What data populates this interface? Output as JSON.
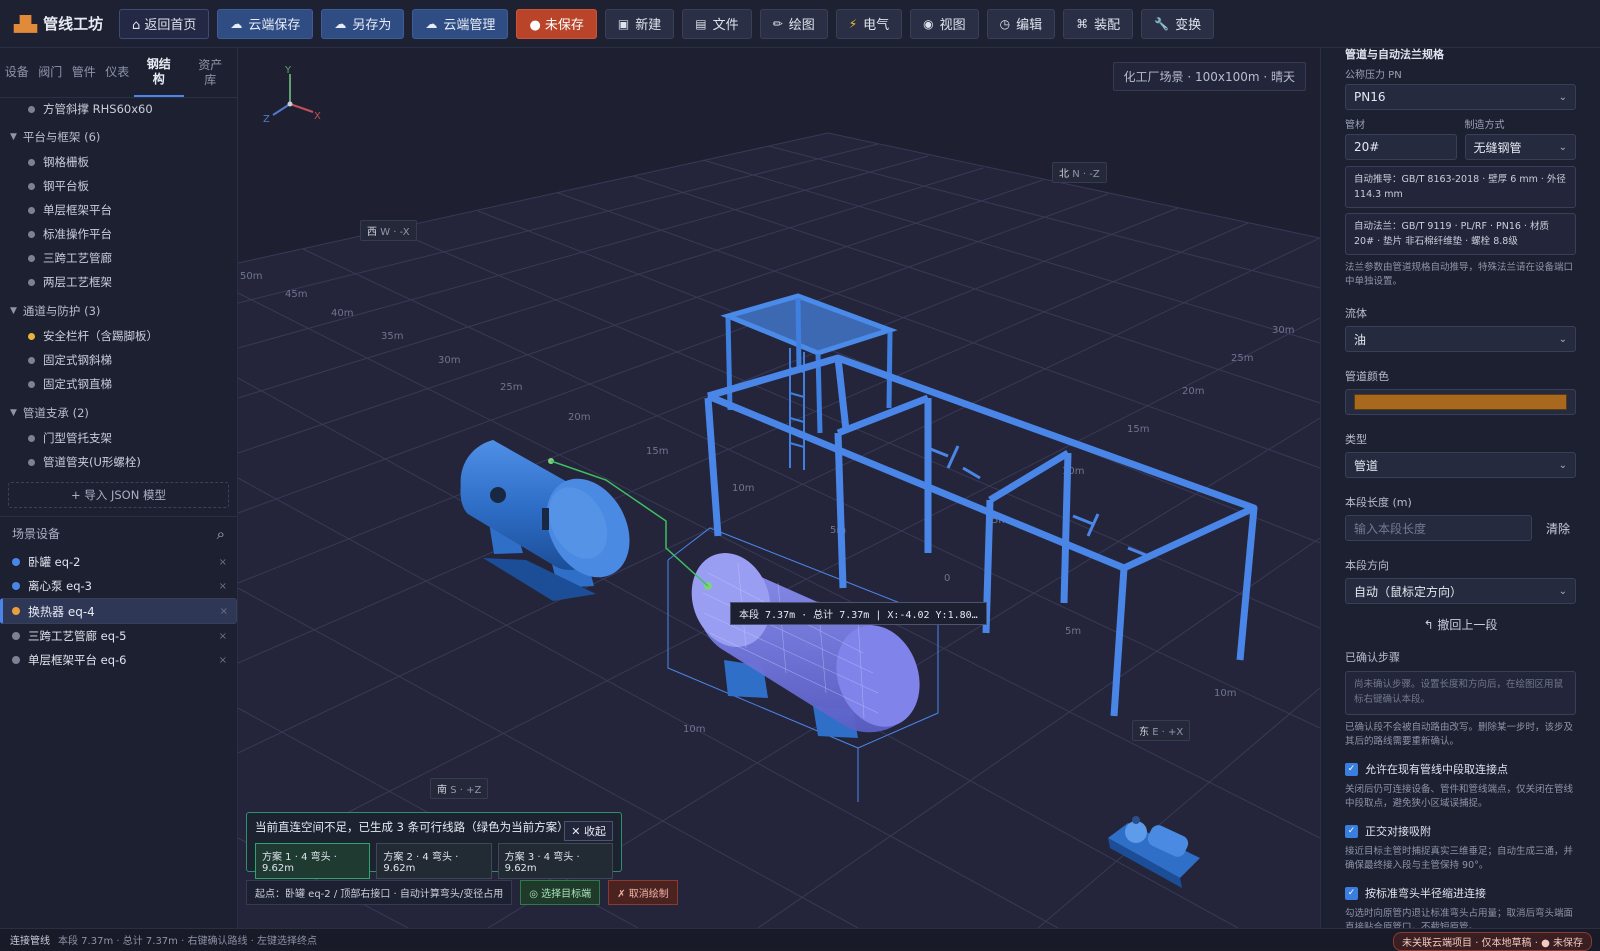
{
  "app": {
    "title": "管线工坊",
    "logo_icon": "factory-icon"
  },
  "toolbar": {
    "home": "⌂ 返回首页",
    "cloud_save": "云端保存",
    "save_as": "另存为",
    "cloud_manage": "云端管理",
    "unsaved": "● 未保存",
    "new": "新建",
    "file": "文件",
    "draw": "绘图",
    "electric": "电气",
    "view": "视图",
    "edit": "编辑",
    "assemble": "装配",
    "transform": "变换"
  },
  "left": {
    "tabs": [
      "设备",
      "阀门",
      "管件",
      "仪表",
      "钢结构",
      "资产库"
    ],
    "active_tab": "钢结构",
    "top_item": "方管斜撑 RHS60x60",
    "groups": [
      {
        "label": "平台与框架 (6)",
        "items": [
          "钢格栅板",
          "钢平台板",
          "单层框架平台",
          "标准操作平台",
          "三跨工艺管廊",
          "两层工艺框架"
        ]
      },
      {
        "label": "通道与防护 (3)",
        "items": [
          "安全栏杆（含踢脚板）",
          "固定式钢斜梯",
          "固定式钢直梯"
        ]
      },
      {
        "label": "管道支承 (2)",
        "items": [
          "门型管托支架",
          "管道管夹(U形螺栓)"
        ]
      }
    ],
    "import_btn": "+ 导入 JSON 模型",
    "scene_title": "场景设备",
    "equipment": [
      {
        "name": "卧罐 eq-2",
        "color": "#4a86e8"
      },
      {
        "name": "离心泵 eq-3",
        "color": "#4a86e8"
      },
      {
        "name": "换热器 eq-4",
        "color": "#e8a03a"
      },
      {
        "name": "三跨工艺管廊 eq-5",
        "color": "#7c8296"
      },
      {
        "name": "单层框架平台 eq-6",
        "color": "#7c8296"
      }
    ],
    "remove_glyph": "×"
  },
  "viewport": {
    "scene_info": "化工厂场景 · 100x100m · 晴天",
    "compass": {
      "north": "北",
      "north_axis": "N · -Z",
      "south": "南",
      "south_axis": "S · +Z",
      "east": "东",
      "east_axis": "E · +X",
      "west": "西",
      "west_axis": "W · -X"
    },
    "axes": {
      "x": "X",
      "y": "Y",
      "z": "Z"
    },
    "grid_labels_left": [
      "50m",
      "45m",
      "40m",
      "35m",
      "30m",
      "25m",
      "20m",
      "15m",
      "10m",
      "5m",
      "0"
    ],
    "grid_labels_right": [
      "30m",
      "25m",
      "20m",
      "15m",
      "10m",
      "5m",
      "0",
      "5m",
      "10m"
    ],
    "grid_labels_front": [
      "5m",
      "10m",
      "5m",
      "10m"
    ],
    "tooltip": "本段 7.37m · 总计 7.37m | X:-4.02 Y:1.80…",
    "route_msg": "当前直连空间不足，已生成 3 条可行线路（绿色为当前方案）",
    "collapse": "✕ 收起",
    "route_options": [
      "方案 1 · 4 弯头 · 9.62m",
      "方案 2 · 4 弯头 · 9.62m",
      "方案 3 · 4 弯头 · 9.62m"
    ],
    "start_info": "起点：卧罐 eq-2 / 顶部右接口 · 自动计算弯头/变径占用",
    "select_target": "◎ 选择目标端",
    "cancel_draw": "✗ 取消绘制"
  },
  "right": {
    "heading": "管道与自动法兰规格",
    "pn_label": "公称压力 PN",
    "pn_value": "PN16",
    "material_label": "管材",
    "material_value": "20#",
    "method_label": "制造方式",
    "method_value": "无缝钢管",
    "auto_spec": "自动推导：GB/T 8163-2018 · 壁厚 6 mm · 外径 114.3 mm",
    "auto_flange": "自动法兰：GB/T 9119 · PL/RF · PN16 · 材质 20# · 垫片 非石棉纤维垫 · 螺栓 8.8级",
    "flange_note": "法兰参数由管道规格自动推导，特殊法兰请在设备端口中单独设置。",
    "fluid_label": "流体",
    "fluid_value": "油",
    "color_label": "管道颜色",
    "pipe_color": "#a8691f",
    "type_label": "类型",
    "type_value": "管道",
    "length_label": "本段长度 (m)",
    "length_placeholder": "输入本段长度",
    "clear": "清除",
    "dir_label": "本段方向",
    "dir_value": "自动（鼠标定方向）",
    "undo": "↰ 撤回上一段",
    "steps_label": "已确认步骤",
    "steps_empty": "尚未确认步骤。设置长度和方向后，在绘图区用鼠标右键确认本段。",
    "steps_note": "已确认段不会被自动路由改写。删除某一步时，该步及其后的路线需要重新确认。",
    "chk1": "允许在现有管线中段取连接点",
    "chk1_note": "关闭后仍可连接设备、管件和管线端点，仅关闭在管线中段取点，避免狭小区域误捕捉。",
    "chk2": "正交对接吸附",
    "chk2_note": "接近目标主管时捕捉真实三维垂足；自动生成三通，并确保最终接入段与主管保持 90°。",
    "chk3": "按标准弯头半径缩进连接",
    "chk3_note": "勾选时向原管内退让标准弯头占用量；取消后弯头端面直接贴合原管口，不截短原管。"
  },
  "status": {
    "mode": "连接管线",
    "text": "本段 7.37m · 总计 7.37m · 右键确认路线 · 左键选择终点",
    "badge": "未关联云端项目 · 仅本地草稿 · ● 未保存"
  }
}
